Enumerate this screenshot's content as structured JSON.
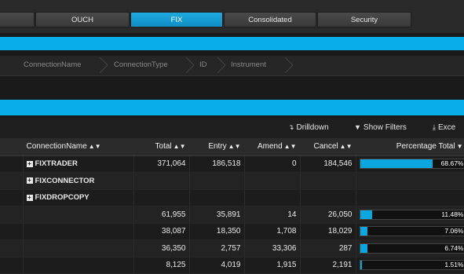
{
  "tabs": [
    {
      "label": "",
      "active": false
    },
    {
      "label": "OUCH",
      "active": false
    },
    {
      "label": "FIX",
      "active": true
    },
    {
      "label": "Consolidated",
      "active": false
    },
    {
      "label": "Security",
      "active": false
    }
  ],
  "breadcrumb": [
    "ConnectionName",
    "ConnectionType",
    "ID",
    "Instrument"
  ],
  "toolbar": {
    "drilldown": "Drilldown",
    "show_filters": "Show Filters",
    "excel": "Exce"
  },
  "columns": [
    "ConnectionName",
    "Total",
    "Entry",
    "Amend",
    "Cancel",
    "Percentage Total"
  ],
  "groups": [
    "FIXTRADER",
    "FIXCONNECTOR",
    "FIXDROPCOPY"
  ],
  "rows": [
    {
      "name_group": 0,
      "total": "371,064",
      "entry": "186,518",
      "amend": "0",
      "cancel": "184,546",
      "pct": "68.67%",
      "pct_value": 68.67
    },
    {
      "name_group": 1,
      "total": "",
      "entry": "",
      "amend": "",
      "cancel": "",
      "pct": "",
      "pct_value": null
    },
    {
      "name_group": 2,
      "total": "",
      "entry": "",
      "amend": "",
      "cancel": "",
      "pct": "",
      "pct_value": null
    },
    {
      "name_group": null,
      "total": "61,955",
      "entry": "35,891",
      "amend": "14",
      "cancel": "26,050",
      "pct": "11.48%",
      "pct_value": 11.48
    },
    {
      "name_group": null,
      "total": "38,087",
      "entry": "18,350",
      "amend": "1,708",
      "cancel": "18,029",
      "pct": "7.06%",
      "pct_value": 7.06
    },
    {
      "name_group": null,
      "total": "36,350",
      "entry": "2,757",
      "amend": "33,306",
      "cancel": "287",
      "pct": "6.74%",
      "pct_value": 6.74
    },
    {
      "name_group": null,
      "total": "8,125",
      "entry": "4,019",
      "amend": "1,915",
      "cancel": "2,191",
      "pct": "1.51%",
      "pct_value": 1.51
    }
  ],
  "colors": {
    "accent": "#07aee8",
    "bar": "#0aa6e0"
  }
}
